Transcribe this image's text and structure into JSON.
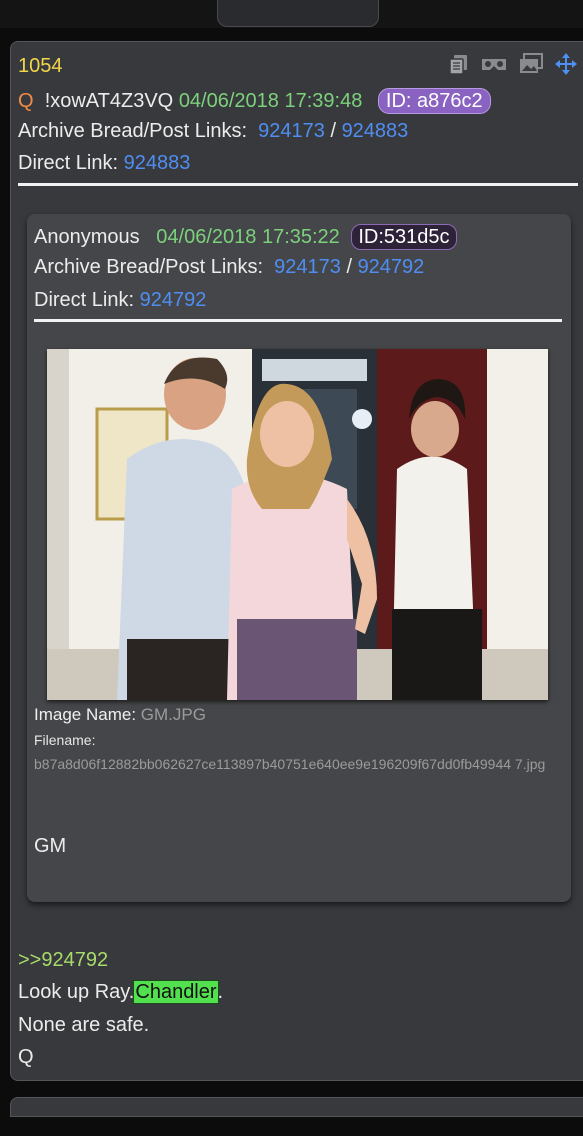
{
  "post": {
    "number": "1054",
    "q_marker": "Q",
    "tripcode": "!xowAT4Z3VQ",
    "timestamp": "04/06/2018 17:39:48",
    "id_badge": "ID: a876c2",
    "archive_label": "Archive Bread/Post Links:",
    "archive_link1": "924173",
    "separator": "/",
    "archive_link2": "924883",
    "direct_label": "Direct Link:",
    "direct_link": "924883",
    "tools": [
      "copy-icon",
      "vr-goggles-icon",
      "image-gallery-icon",
      "move-arrows-icon"
    ]
  },
  "quoted": {
    "author": "Anonymous",
    "timestamp": "04/06/2018 17:35:22",
    "id_badge": "ID:531d5c",
    "archive_label": "Archive Bread/Post Links:",
    "archive_link1": "924173",
    "separator": "/",
    "archive_link2": "924792",
    "direct_label": "Direct Link:",
    "direct_link": "924792",
    "image_name_label": "Image Name:",
    "image_name": "GM.JPG",
    "filename_label": "Filename:",
    "filename": "b87a8d06f12882bb062627ce113897b40751e640ee9e196209f67dd0fb49944 7.jpg",
    "body": "GM"
  },
  "reply": {
    "quote_ref": ">>924792",
    "line1_prefix": "Look up Ray.",
    "line1_highlight": "Chandler",
    "line1_suffix": ".",
    "line2": "None are safe.",
    "line3": "Q"
  },
  "colors": {
    "background": "#38393c",
    "number": "#f2d64a",
    "green_text": "#7cd17c",
    "link": "#4f8ef2",
    "q_marker": "#f08b48",
    "id_badge": "#8a63c2",
    "highlight": "#52e04e"
  }
}
